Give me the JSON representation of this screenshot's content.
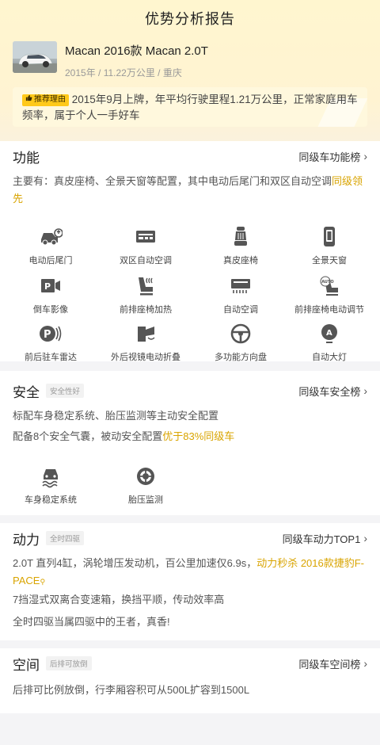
{
  "page_title": "优势分析报告",
  "car": {
    "name": "Macan 2016款 Macan 2.0T",
    "meta": "2015年 / 11.22万公里 / 重庆"
  },
  "recommend": {
    "badge": "推荐理由",
    "text": "2015年9月上牌，年平均行驶里程1.21万公里，正常家庭用车频率，属于个人一手好车"
  },
  "features": {
    "title": "功能",
    "link": "同级车功能榜",
    "desc_prefix": "主要有：真皮座椅、全景天窗等配置，其中电动后尾门和双区自动空调",
    "desc_highlight": "同级领先",
    "items": [
      {
        "label": "电动后尾门",
        "icon": "power-tailgate-icon"
      },
      {
        "label": "双区自动空调",
        "icon": "dual-zone-ac-icon"
      },
      {
        "label": "真皮座椅",
        "icon": "leather-seat-icon"
      },
      {
        "label": "全景天窗",
        "icon": "panoramic-sunroof-icon"
      },
      {
        "label": "倒车影像",
        "icon": "reverse-camera-icon"
      },
      {
        "label": "前排座椅加热",
        "icon": "seat-heating-icon"
      },
      {
        "label": "自动空调",
        "icon": "auto-ac-icon"
      },
      {
        "label": "前排座椅电动调节",
        "icon": "power-seat-adjust-icon"
      },
      {
        "label": "前后驻车雷达",
        "icon": "parking-radar-icon"
      },
      {
        "label": "外后视镜电动折叠",
        "icon": "mirror-fold-icon"
      },
      {
        "label": "多功能方向盘",
        "icon": "steering-wheel-icon"
      },
      {
        "label": "自动大灯",
        "icon": "auto-headlight-icon"
      }
    ]
  },
  "safety": {
    "title": "安全",
    "tag": "安全性好",
    "link": "同级车安全榜",
    "line1": "标配车身稳定系统、胎压监测等主动安全配置",
    "line2_prefix": "配备8个安全气囊，被动安全配置",
    "line2_highlight": "优于83%同级车",
    "items": [
      {
        "label": "车身稳定系统",
        "icon": "stability-control-icon"
      },
      {
        "label": "胎压监测",
        "icon": "tire-pressure-icon"
      }
    ]
  },
  "power": {
    "title": "动力",
    "tag": "全时四驱",
    "link": "同级车动力TOP1",
    "line1_prefix": "2.0T 直列4缸，涡轮增压发动机，百公里加速仅6.9s，",
    "line1_highlight": "动力秒杀 2016款捷豹F-PACE",
    "line2": "7挡湿式双离合变速箱，换挡平顺，传动效率高",
    "line3": "全时四驱当属四驱中的王者，真香!"
  },
  "space": {
    "title": "空间",
    "tag": "后排可放倒",
    "link": "同级车空间榜",
    "line1": "后排可比例放倒，行李厢容积可从500L扩容到1500L"
  },
  "colors": {
    "accent": "#d9a400",
    "badge": "#ffc91a",
    "icon": "#555555"
  }
}
